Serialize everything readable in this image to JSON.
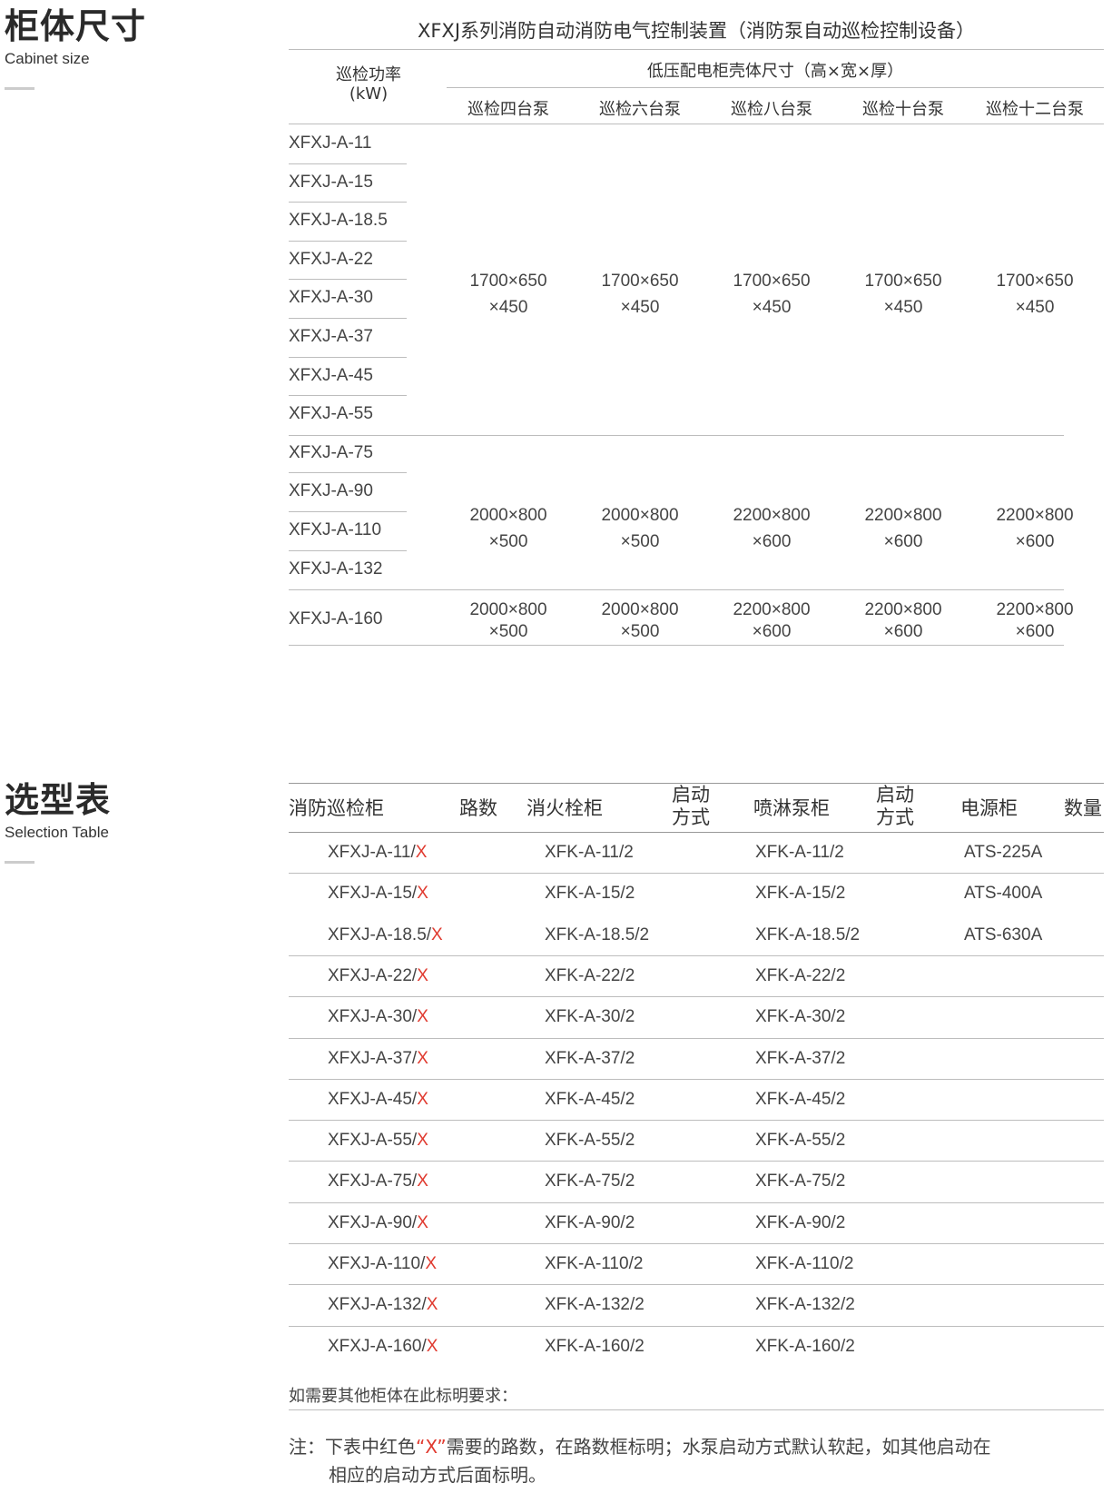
{
  "section1": {
    "title": "柜体尺寸",
    "subtitle": "Cabinet size"
  },
  "table1": {
    "title": "XFXJ系列消防自动消防电气控制装置（消防泵自动巡检控制设备）",
    "power_header": "巡检功率\n(kW)",
    "dim_header": "低压配电柜壳体尺寸（高×宽×厚）",
    "columns": [
      "巡检四台泵",
      "巡检六台泵",
      "巡检八台泵",
      "巡检十台泵",
      "巡检十二台泵"
    ],
    "models": [
      "XFXJ-A-11",
      "XFXJ-A-15",
      "XFXJ-A-18.5",
      "XFXJ-A-22",
      "XFXJ-A-30",
      "XFXJ-A-37",
      "XFXJ-A-45",
      "XFXJ-A-55",
      "XFXJ-A-75",
      "XFXJ-A-90",
      "XFXJ-A-110",
      "XFXJ-A-132",
      "XFXJ-A-160"
    ],
    "groups": [
      {
        "dims": [
          [
            "1700×650",
            "×450"
          ],
          [
            "1700×650",
            "×450"
          ],
          [
            "1700×650",
            "×450"
          ],
          [
            "1700×650",
            "×450"
          ],
          [
            "1700×650",
            "×450"
          ]
        ]
      },
      {
        "dims": [
          [
            "2000×800",
            "×500"
          ],
          [
            "2000×800",
            "×500"
          ],
          [
            "2200×800",
            "×600"
          ],
          [
            "2200×800",
            "×600"
          ],
          [
            "2200×800",
            "×600"
          ]
        ]
      },
      {
        "dims": [
          [
            "2000×800",
            "×500"
          ],
          [
            "2000×800",
            "×500"
          ],
          [
            "2200×800",
            "×600"
          ],
          [
            "2200×800",
            "×600"
          ],
          [
            "2200×800",
            "×600"
          ]
        ]
      }
    ]
  },
  "section2": {
    "title": "选型表",
    "subtitle": "Selection Table"
  },
  "table2": {
    "headers": {
      "cabinet": "消防巡检柜",
      "routes": "路数",
      "hydrant": "消火栓柜",
      "start1": "启动\n方式",
      "sprinkler": "喷淋泵柜",
      "start2": "启动\n方式",
      "power": "电源柜",
      "qty": "数量"
    },
    "rows": [
      {
        "cabinet": "XFXJ-A-11/",
        "x": "X",
        "hydrant": "XFK-A-11/2",
        "sprinkler": "XFK-A-11/2",
        "power": "ATS-225A"
      },
      {
        "cabinet": "XFXJ-A-15/",
        "x": "X",
        "hydrant": "XFK-A-15/2",
        "sprinkler": "XFK-A-15/2",
        "power": "ATS-400A"
      },
      {
        "cabinet": "XFXJ-A-18.5/",
        "x": "X",
        "hydrant": "XFK-A-18.5/2",
        "sprinkler": "XFK-A-18.5/2",
        "power": "ATS-630A"
      },
      {
        "cabinet": "XFXJ-A-22/",
        "x": "X",
        "hydrant": "XFK-A-22/2",
        "sprinkler": "XFK-A-22/2",
        "power": ""
      },
      {
        "cabinet": "XFXJ-A-30/",
        "x": "X",
        "hydrant": "XFK-A-30/2",
        "sprinkler": "XFK-A-30/2",
        "power": ""
      },
      {
        "cabinet": "XFXJ-A-37/",
        "x": "X",
        "hydrant": "XFK-A-37/2",
        "sprinkler": "XFK-A-37/2",
        "power": ""
      },
      {
        "cabinet": "XFXJ-A-45/",
        "x": "X",
        "hydrant": "XFK-A-45/2",
        "sprinkler": "XFK-A-45/2",
        "power": ""
      },
      {
        "cabinet": "XFXJ-A-55/",
        "x": "X",
        "hydrant": "XFK-A-55/2",
        "sprinkler": "XFK-A-55/2",
        "power": ""
      },
      {
        "cabinet": "XFXJ-A-75/",
        "x": "X",
        "hydrant": "XFK-A-75/2",
        "sprinkler": "XFK-A-75/2",
        "power": ""
      },
      {
        "cabinet": "XFXJ-A-90/",
        "x": "X",
        "hydrant": "XFK-A-90/2",
        "sprinkler": "XFK-A-90/2",
        "power": ""
      },
      {
        "cabinet": "XFXJ-A-110/",
        "x": "X",
        "hydrant": "XFK-A-110/2",
        "sprinkler": "XFK-A-110/2",
        "power": ""
      },
      {
        "cabinet": "XFXJ-A-132/",
        "x": "X",
        "hydrant": "XFK-A-132/2",
        "sprinkler": "XFK-A-132/2",
        "power": ""
      },
      {
        "cabinet": "XFXJ-A-160/",
        "x": "X",
        "hydrant": "XFK-A-160/2",
        "sprinkler": "XFK-A-160/2",
        "power": ""
      }
    ],
    "note_custom": "如需要其他柜体在此标明要求：",
    "note": {
      "prefix": "注：下表中红色",
      "quoted": "“X”",
      "line1_rest": "需要的路数，在路数框标明；水泵启动方式默认软起，如其他启动在",
      "line2": "相应的启动方式后面标明。"
    }
  },
  "colors": {
    "accent_red": "#e03a2f",
    "rule": "#bdbdbd",
    "text": "#444444"
  }
}
